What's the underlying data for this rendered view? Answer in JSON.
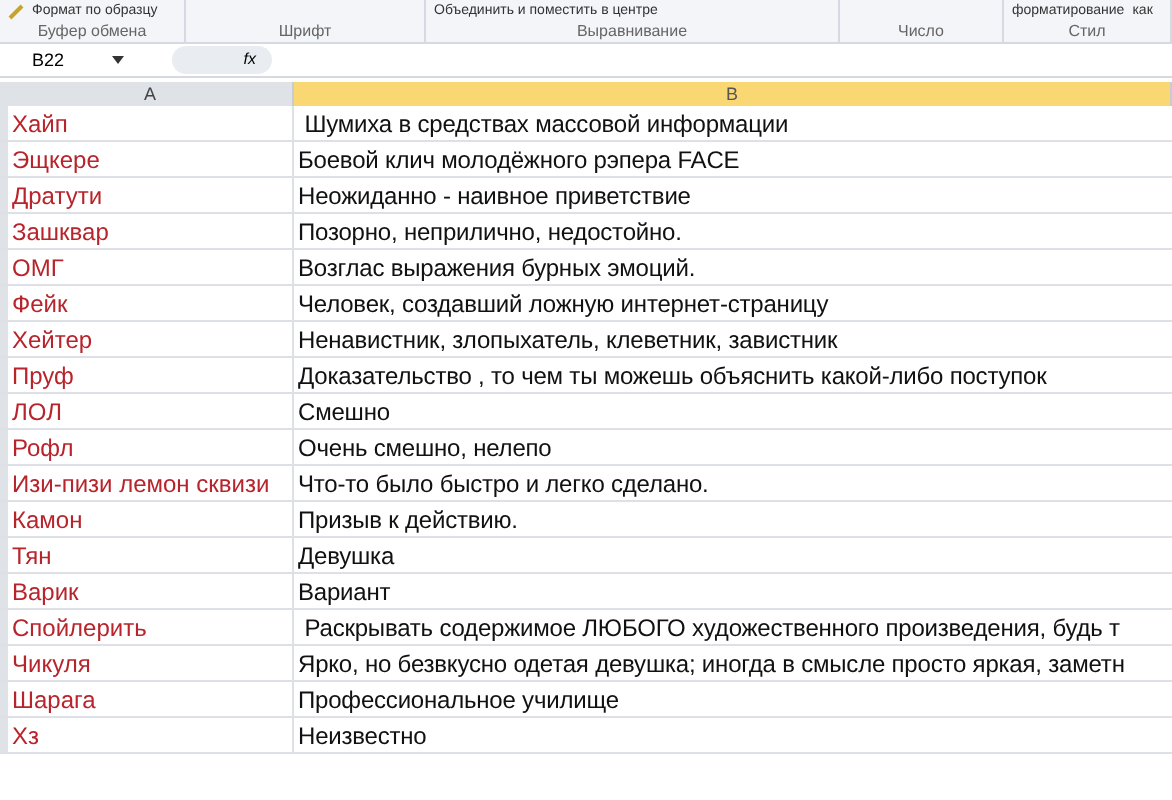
{
  "ribbon": {
    "groups": [
      {
        "label": "Буфер обмена",
        "items": [
          "Формат по образцу"
        ]
      },
      {
        "label": "Шрифт"
      },
      {
        "label": "Выравнивание",
        "items": [
          "Объединить и поместить в центре"
        ]
      },
      {
        "label": "Число"
      },
      {
        "label": "Стил",
        "items": [
          "форматирование",
          "как"
        ]
      }
    ]
  },
  "formula_bar": {
    "name_box": "B22",
    "fx": "fx"
  },
  "columns": [
    {
      "label": "A",
      "selected": false
    },
    {
      "label": "B",
      "selected": true
    }
  ],
  "rows": [
    {
      "term": "Хайп",
      "definition": " Шумиха в средствах массовой информации"
    },
    {
      "term": "Эщкере",
      "definition": "Боевой клич молодёжного рэпера FACE"
    },
    {
      "term": "Дратути",
      "definition": "Неожиданно - наивное приветствие"
    },
    {
      "term": "Зашквар",
      "definition": "Позорно, неприлично, недостойно."
    },
    {
      "term": "ОМГ",
      "definition": "Возглас выражения бурных эмоций."
    },
    {
      "term": "Фейк",
      "definition": "Человек, создавший ложную интернет-страницу"
    },
    {
      "term": "Хейтер",
      "definition": "Ненавистник, злопыхатель, клеветник, завистник"
    },
    {
      "term": "Пруф",
      "definition": "Доказательство , то чем ты можешь объяснить какой-либо поступок"
    },
    {
      "term": "ЛОЛ",
      "definition": "Смешно"
    },
    {
      "term": "Рофл",
      "definition": "Очень смешно, нелепо"
    },
    {
      "term": "Изи-пизи лемон сквизи",
      "definition": "Что-то было быстро и легко сделано."
    },
    {
      "term": "Камон",
      "definition": "Призыв к действию."
    },
    {
      "term": "Тян",
      "definition": "Девушка"
    },
    {
      "term": "Варик",
      "definition": "Вариант"
    },
    {
      "term": "Спойлерить",
      "definition": " Раскрывать содержимое ЛЮБОГО художественного произведения, будь т"
    },
    {
      "term": "Чикуля",
      "definition": "Ярко, но безвкусно одетая девушка; иногда в смысле просто яркая, заметн"
    },
    {
      "term": "Шарага",
      "definition": "Профессиональное училище"
    },
    {
      "term": "Хз",
      "definition": "Неизвестно"
    }
  ]
}
